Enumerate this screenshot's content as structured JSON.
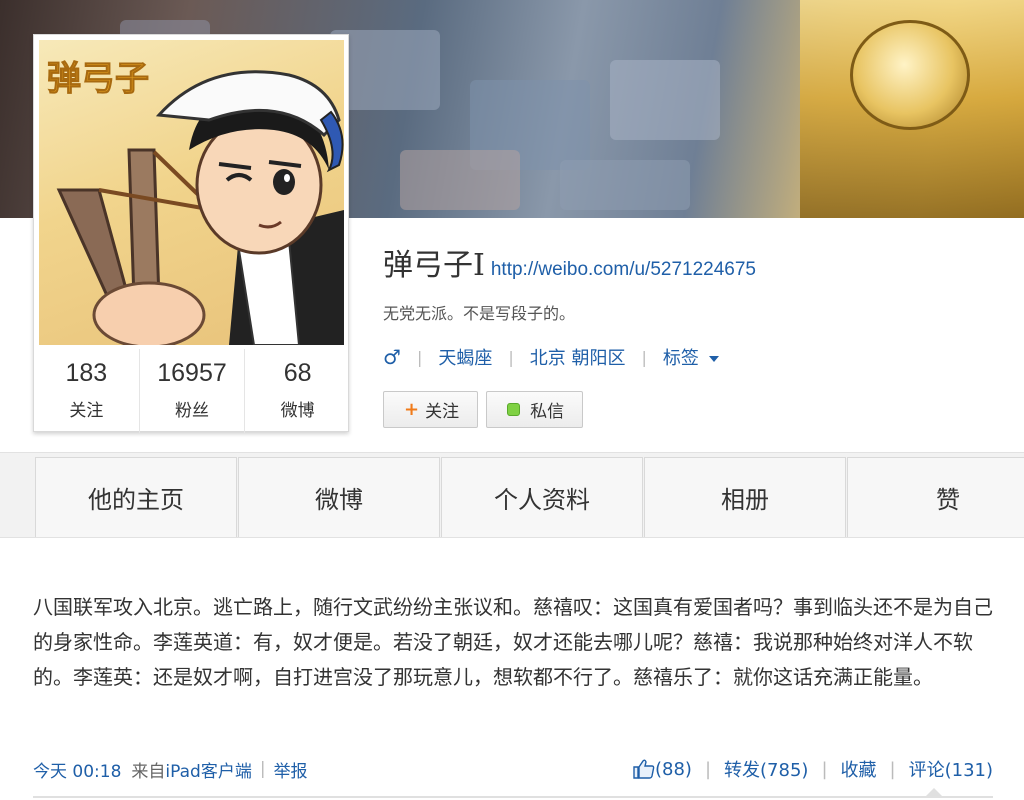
{
  "profile": {
    "name": "弹弓子I",
    "url": "http://weibo.com/u/5271224675",
    "bio": "无党无派。不是写段子的。",
    "gender_symbol": "♂",
    "zodiac": "天蝎座",
    "location": "北京 朝阳区",
    "tags_label": "标签",
    "avatar_text": "弹弓子"
  },
  "stats": [
    {
      "value": "183",
      "label": "关注"
    },
    {
      "value": "16957",
      "label": "粉丝"
    },
    {
      "value": "68",
      "label": "微博"
    }
  ],
  "buttons": {
    "follow_plus": "+",
    "follow": "关注",
    "message": "私信"
  },
  "tabs": [
    "他的主页",
    "微博",
    "个人资料",
    "相册",
    "赞"
  ],
  "post": {
    "text": "八国联军攻入北京。逃亡路上，随行文武纷纷主张议和。慈禧叹：这国真有爱国者吗？事到临头还不是为自己的身家性命。李莲英道：有，奴才便是。若没了朝廷，奴才还能去哪儿呢？慈禧：我说那种始终对洋人不软的。李莲英：还是奴才啊，自打进宫没了那玩意儿，想软都不行了。慈禧乐了：就你这话充满正能量。",
    "time": "今天 00:18",
    "from_label": "来自",
    "source": "iPad客户端",
    "report": "举报",
    "likes": "(88)",
    "repost": "转发(785)",
    "favorite": "收藏",
    "comment": "评论(131)"
  },
  "colors": {
    "link": "#1f5fa8",
    "follow_plus": "#f07b1a",
    "message_dot": "#7fd143"
  }
}
